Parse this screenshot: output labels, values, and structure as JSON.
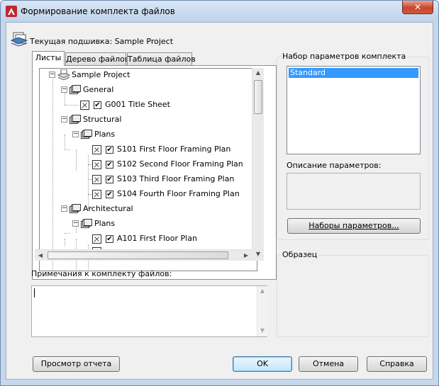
{
  "window": {
    "title": "Формирование комплекта файлов",
    "close_glyph": "✕",
    "accent_color": "#3399ff"
  },
  "header": {
    "current_set_label": "Текущая подшивка: Sample Project"
  },
  "tabs": [
    {
      "label": "Листы",
      "active": true
    },
    {
      "label": "Дерево файлов",
      "active": false
    },
    {
      "label": "Таблица файлов",
      "active": false
    }
  ],
  "tree": {
    "root": "Sample Project",
    "nodes": [
      {
        "label": "General",
        "kind": "subset"
      },
      {
        "label": "G001 Title Sheet",
        "kind": "sheet",
        "checked": true
      },
      {
        "label": "Structural",
        "kind": "subset"
      },
      {
        "label": "Plans",
        "kind": "subset"
      },
      {
        "label": "S101 First Floor Framing Plan",
        "kind": "sheet",
        "checked": true
      },
      {
        "label": "S102 Second Floor Framing Plan",
        "kind": "sheet",
        "checked": true
      },
      {
        "label": "S103 Third Floor Framing Plan",
        "kind": "sheet",
        "checked": true
      },
      {
        "label": "S104 Fourth Floor Framing Plan",
        "kind": "sheet",
        "checked": true
      },
      {
        "label": "Architectural",
        "kind": "subset"
      },
      {
        "label": "Plans",
        "kind": "subset"
      },
      {
        "label": "A101 First Floor Plan",
        "kind": "sheet",
        "checked": true
      }
    ]
  },
  "notes": {
    "label": "Примечания к комплекту файлов:",
    "value": ""
  },
  "transmittal_setups": {
    "group_label": "Набор параметров комплекта",
    "items": [
      "Standard"
    ],
    "selected": "Standard",
    "description_label": "Описание параметров:",
    "description_value": "",
    "setups_button": "Наборы параметров..."
  },
  "preview": {
    "group_label": "Образец"
  },
  "buttons": {
    "view_report": "Просмотр отчета",
    "ok": "OK",
    "cancel": "Отмена",
    "help": "Справка"
  },
  "icons": {
    "app": "autocad-logo-icon",
    "sheet_set": "sheet-set-icon",
    "subset": "subset-folder-icon",
    "sheet": "sheet-icon",
    "checkbox_checked": "✔",
    "expanded": "−",
    "scroll_up": "▲",
    "scroll_down": "▼",
    "scroll_left": "◀",
    "scroll_right": "▶"
  }
}
